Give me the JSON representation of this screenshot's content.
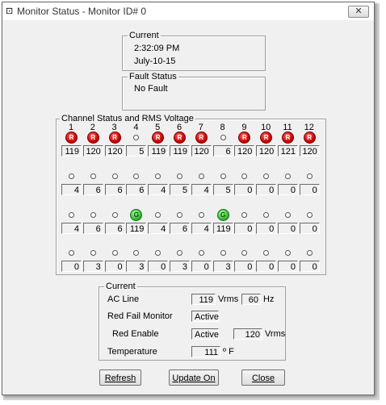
{
  "window": {
    "title": "Monitor Status - Monitor ID# 0",
    "close_label": "✕",
    "icon_glyph": "⊡"
  },
  "current_time": {
    "legend": "Current",
    "time": "2:32:09 PM",
    "date": "July-10-15"
  },
  "fault": {
    "legend": "Fault Status",
    "text": "No Fault"
  },
  "channels": {
    "legend": "Channel Status and RMS Voltage",
    "numbers": [
      "1",
      "2",
      "3",
      "4",
      "5",
      "6",
      "7",
      "8",
      "9",
      "10",
      "11",
      "12"
    ],
    "rows": [
      {
        "indicators": [
          "R",
          "R",
          "R",
          "off",
          "R",
          "R",
          "R",
          "off",
          "R",
          "R",
          "R",
          "R"
        ],
        "values": [
          "119",
          "120",
          "120",
          "5",
          "119",
          "119",
          "120",
          "6",
          "120",
          "120",
          "121",
          "120"
        ]
      },
      {
        "indicators": [
          "off",
          "off",
          "off",
          "off",
          "off",
          "off",
          "off",
          "off",
          "off",
          "off",
          "off",
          "off"
        ],
        "values": [
          "4",
          "6",
          "6",
          "6",
          "4",
          "5",
          "4",
          "5",
          "0",
          "0",
          "0",
          "0"
        ]
      },
      {
        "indicators": [
          "off",
          "off",
          "off",
          "G",
          "off",
          "off",
          "off",
          "G",
          "off",
          "off",
          "off",
          "off"
        ],
        "values": [
          "4",
          "6",
          "6",
          "119",
          "4",
          "6",
          "4",
          "119",
          "0",
          "0",
          "0",
          "0"
        ]
      },
      {
        "indicators": [
          "off",
          "off",
          "off",
          "off",
          "off",
          "off",
          "off",
          "off",
          "off",
          "off",
          "off",
          "off"
        ],
        "values": [
          "0",
          "3",
          "0",
          "3",
          "0",
          "3",
          "0",
          "3",
          "0",
          "0",
          "0",
          "0"
        ]
      }
    ]
  },
  "current_ac": {
    "legend": "Current",
    "ac_line_label": "AC Line",
    "ac_line_value": "119",
    "vrms_unit": "Vrms",
    "freq_value": "60",
    "hz_unit": "Hz",
    "red_fail_label": "Red Fail Monitor",
    "red_fail_value": "Active",
    "red_enable_label": "Red Enable",
    "red_enable_value": "Active",
    "red_enable_volt": "120",
    "red_enable_unit": "Vrms",
    "temp_label": "Temperature",
    "temp_value": "111",
    "temp_unit": "º F"
  },
  "buttons": {
    "refresh": "Refresh",
    "update_on": "Update On",
    "close": "Close"
  }
}
